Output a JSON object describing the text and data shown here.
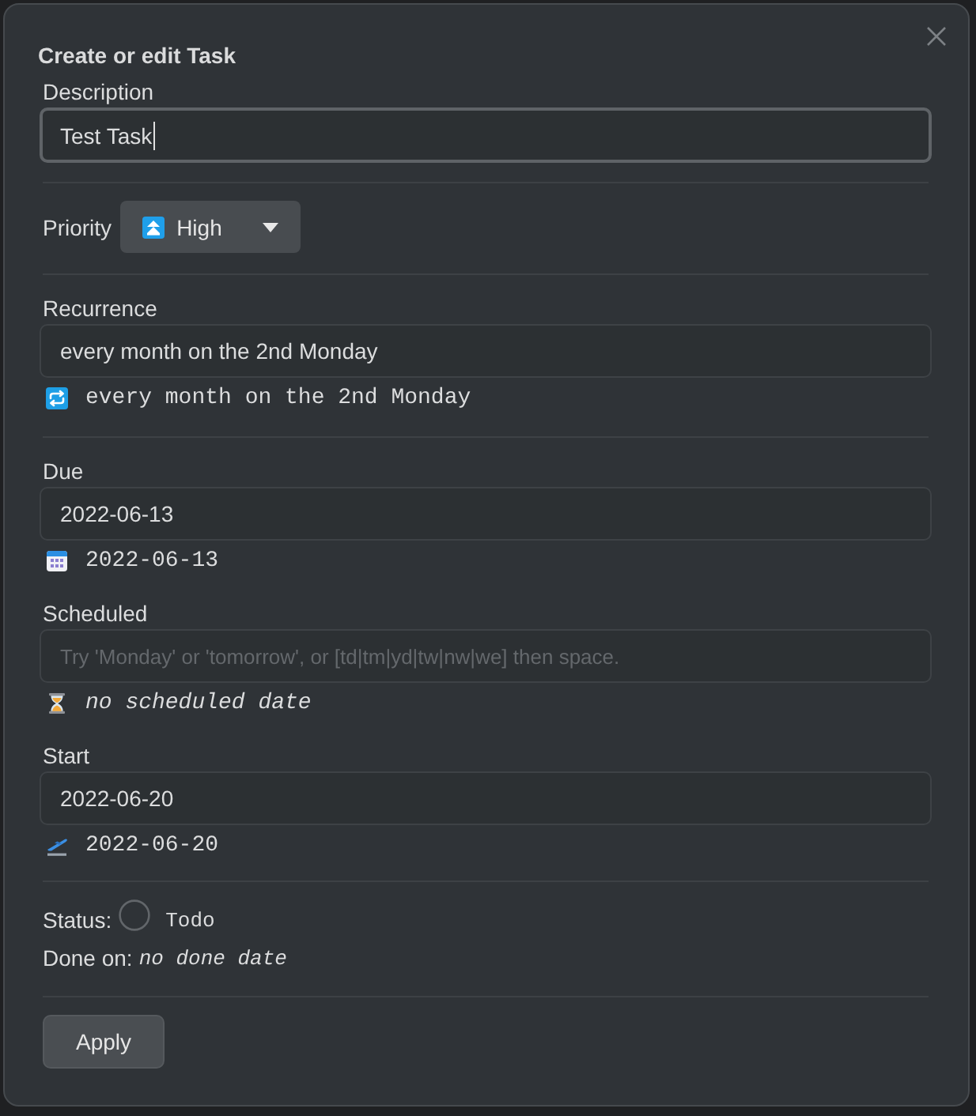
{
  "dialog": {
    "title": "Create or edit Task"
  },
  "description": {
    "label": "Description",
    "value": "Test Task",
    "focused": true
  },
  "priority": {
    "label": "Priority",
    "value": "High"
  },
  "recurrence": {
    "label": "Recurrence",
    "value": "every month on the 2nd Monday",
    "preview": "every month on the 2nd Monday"
  },
  "dates": [
    {
      "kind": "due",
      "label": "Due",
      "value": "2022-06-13",
      "preview": "2022-06-13"
    },
    {
      "kind": "scheduled",
      "label": "Scheduled",
      "placeholder": "Try 'Monday' or 'tomorrow', or [td|tm|yd|tw|nw|we] then space.",
      "preview": "no scheduled date"
    },
    {
      "kind": "start",
      "label": "Start",
      "value": "2022-06-20",
      "preview": "2022-06-20"
    }
  ],
  "status": {
    "label": "Status:",
    "checked": false,
    "value": "Todo"
  },
  "done_on": {
    "label": "Done on:",
    "value": "no done date",
    "empty": true
  },
  "buttons": [
    {
      "label": "Apply"
    }
  ]
}
